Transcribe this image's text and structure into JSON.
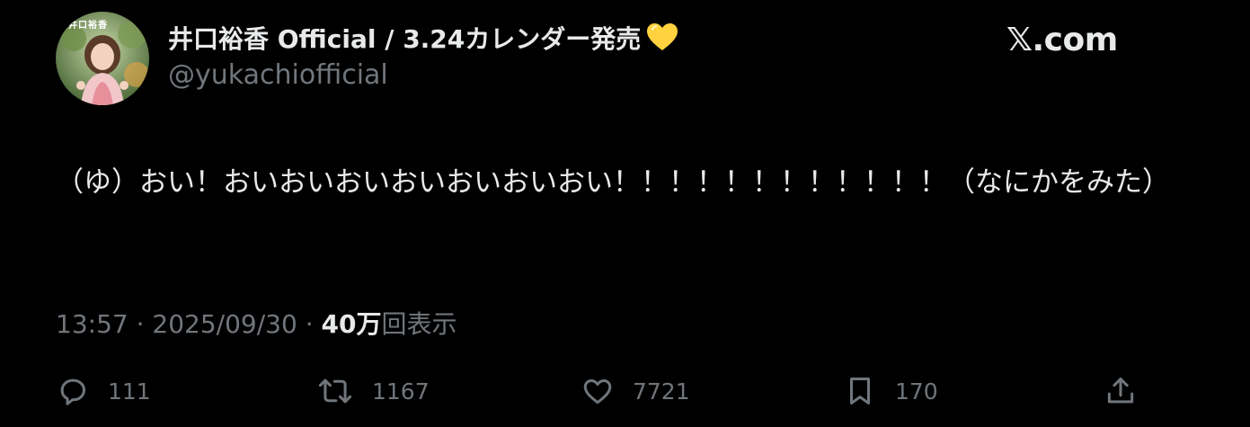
{
  "author": {
    "display_name": "井口裕香 Official / 3.24カレンダー発売",
    "handle": "@yukachiofficial",
    "avatar_text": "井口裕香"
  },
  "brand": {
    "label": "𝕏.com"
  },
  "tweet": {
    "text": "（ゆ）おい！おいおいおいおいおいおいおい！！！！！！！！！！！！（なにかをみた）"
  },
  "meta": {
    "time": "13:57",
    "separator": "·",
    "date": "2025/09/30",
    "views_count": "40万",
    "views_label": "回表示"
  },
  "actions": {
    "replies": "111",
    "reposts": "1167",
    "likes": "7721",
    "bookmarks": "170"
  },
  "icons": {
    "heart": "yellow-heart-icon",
    "reply": "reply-icon",
    "repost": "repost-icon",
    "like": "like-icon",
    "bookmark": "bookmark-icon",
    "share": "share-icon"
  },
  "colors": {
    "background": "#000000",
    "text_primary": "#e7e9ea",
    "text_secondary": "#71767b",
    "heart": "#ffd23e"
  }
}
